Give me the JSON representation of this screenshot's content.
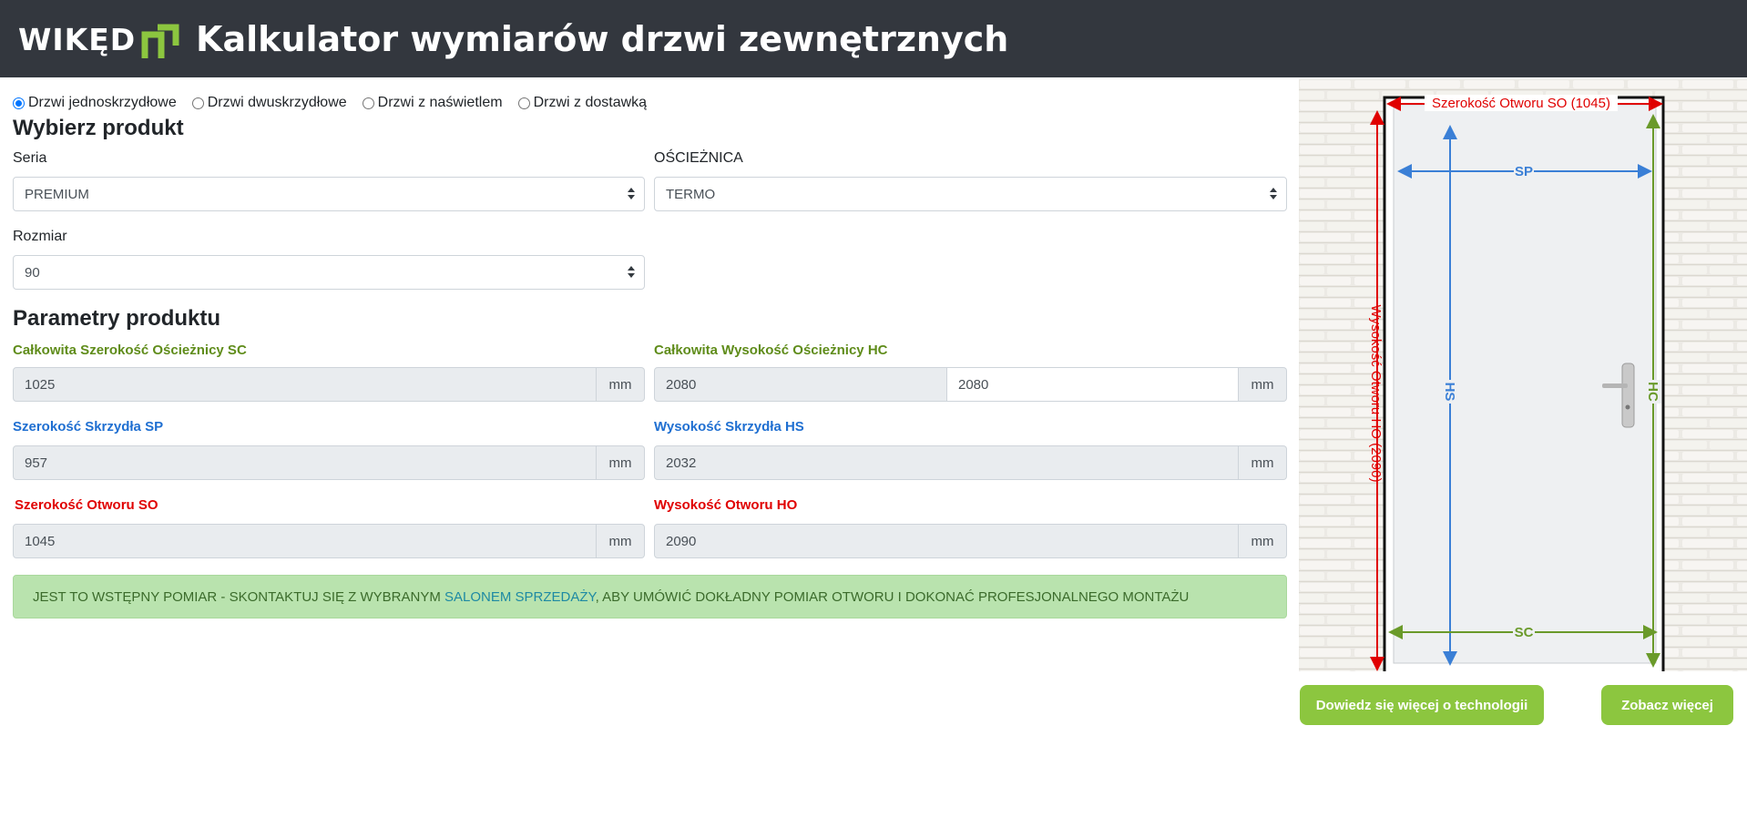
{
  "header": {
    "logo_text": "WIKĘD",
    "title": "Kalkulator wymiarów drzwi zewnętrznych"
  },
  "door_type": {
    "options": [
      {
        "label": "Drzwi jednoskrzydłowe",
        "selected": true
      },
      {
        "label": "Drzwi dwuskrzydłowe",
        "selected": false
      },
      {
        "label": "Drzwi z naświetlem",
        "selected": false
      },
      {
        "label": "Drzwi z dostawką",
        "selected": false
      }
    ]
  },
  "product": {
    "heading": "Wybierz produkt",
    "series_label": "Seria",
    "series_value": "PREMIUM",
    "frame_label": "OŚCIEŻNICA",
    "frame_value": "TERMO",
    "size_label": "Rozmiar",
    "size_value": "90"
  },
  "params": {
    "heading": "Parametry produktu",
    "sc_label": "Całkowita Szerokość Ościeżnicy SC",
    "sc_value": "1025",
    "hc_label": "Całkowita Wysokość Ościeżnicy HC",
    "hc_value": "2080",
    "hc_value_input": "2080",
    "sp_label": "Szerokość Skrzydła SP",
    "sp_value": "957",
    "hs_label": "Wysokość Skrzydła HS",
    "hs_value": "2032",
    "so_label": "Szerokość Otworu SO",
    "so_value": "1045",
    "ho_label": "Wysokość Otworu HO",
    "ho_value": "2090",
    "unit": "mm"
  },
  "alert": {
    "text_before": "JEST TO WSTĘPNY POMIAR - SKONTAKTUJ SIĘ Z WYBRANYM ",
    "link_text": "SALONEM SPRZEDAŻY",
    "text_after": ", ABY UMÓWIĆ DOKŁADNY POMIAR OTWORU I DOKONAĆ PROFESJONALNEGO MONTAŻU"
  },
  "diagram": {
    "so_label": "Szerokość Otworu SO (1045)",
    "ho_label": "Wysokość Otworu HO (2090)",
    "sp_label": "SP",
    "hs_label": "HS",
    "hc_label": "HC",
    "sc_label": "SC",
    "colors": {
      "red": "#e00000",
      "blue": "#3a7fd6",
      "green": "#6a9a2a"
    }
  },
  "buttons": {
    "learn_more": "Dowiedz się więcej o technologii",
    "see_more": "Zobacz więcej"
  },
  "colors": {
    "header_bg": "#33373e",
    "accent_green": "#8cc63f",
    "logo_green": "#8cc63f"
  }
}
